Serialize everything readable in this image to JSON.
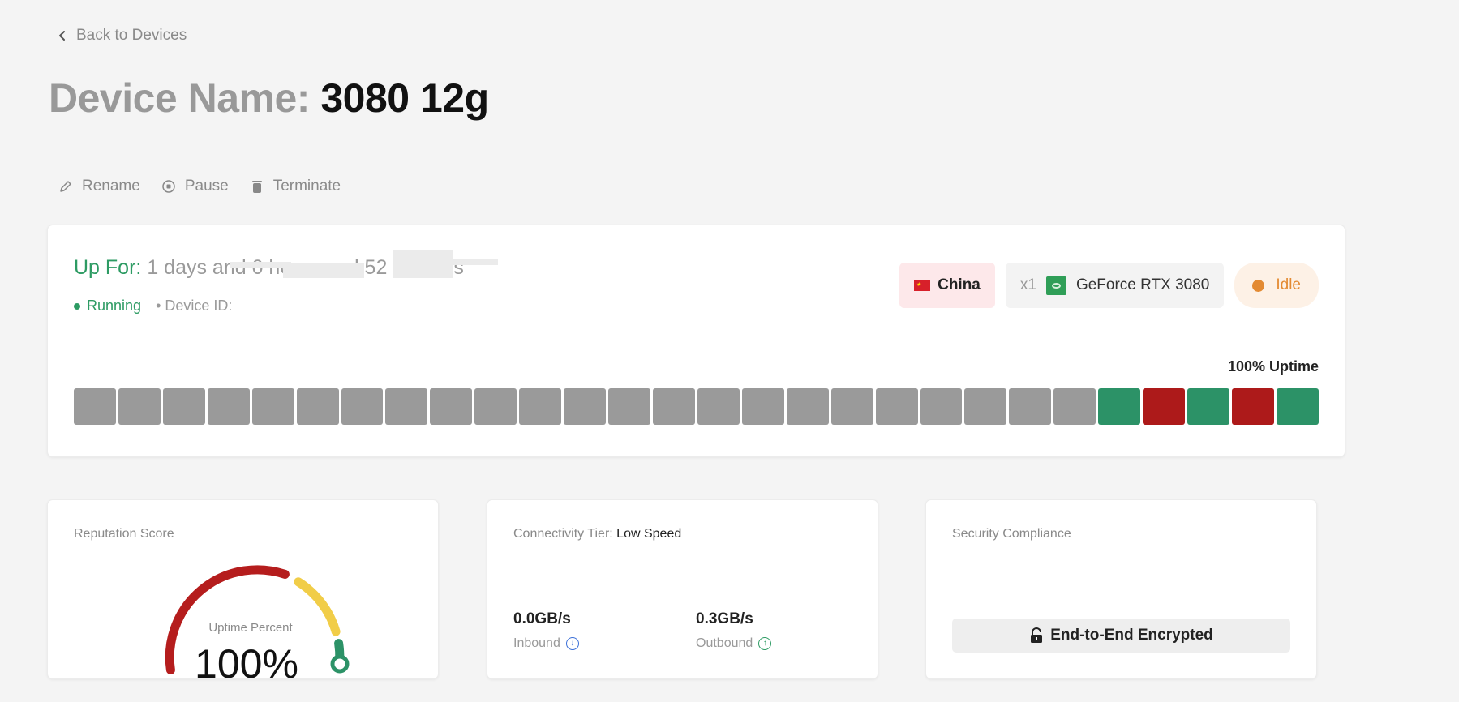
{
  "nav": {
    "back_label": "Back to Devices"
  },
  "title": {
    "prefix": "Device Name:",
    "name": "3080 12g"
  },
  "actions": [
    {
      "label": "Rename",
      "icon": "pencil-icon"
    },
    {
      "label": "Pause",
      "icon": "pause-circle-icon"
    },
    {
      "label": "Terminate",
      "icon": "trash-icon"
    }
  ],
  "status_card": {
    "up_for_label": "Up For:",
    "up_for_value": "1 days and 0 hours and 52 minutes",
    "state": "Running",
    "device_id_label": "• Device ID:",
    "country": "China",
    "gpu_count": "x1",
    "gpu_name": "GeForce RTX 3080",
    "activity": "Idle",
    "uptime_label": "100% Uptime",
    "uptime_segments": [
      "none",
      "none",
      "none",
      "none",
      "none",
      "none",
      "none",
      "none",
      "none",
      "none",
      "none",
      "none",
      "none",
      "none",
      "none",
      "none",
      "none",
      "none",
      "none",
      "none",
      "none",
      "none",
      "none",
      "up",
      "down",
      "up",
      "down",
      "up"
    ],
    "colors": {
      "up": "#2c9267",
      "down": "#ad1a1a",
      "none": "#9a9a9a",
      "accent": "#2d9b63",
      "idle": "#e38a32"
    }
  },
  "reputation": {
    "title": "Reputation Score",
    "gauge_label": "Uptime Percent",
    "gauge_value": "100%",
    "gauge_fraction": 1.0
  },
  "connectivity": {
    "title_label": "Connectivity Tier:",
    "tier": "Low Speed",
    "inbound_value": "0.0GB/s",
    "inbound_label": "Inbound",
    "outbound_value": "0.3GB/s",
    "outbound_label": "Outbound"
  },
  "security": {
    "title": "Security Compliance",
    "badge": "End-to-End Encrypted"
  }
}
